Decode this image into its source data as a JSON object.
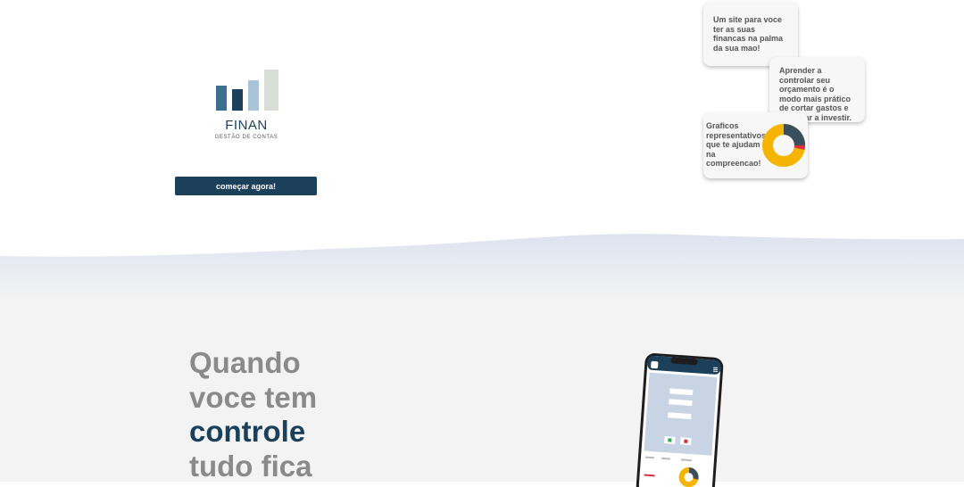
{
  "logo": {
    "title": "FINAN",
    "subtitle": "GESTÃO DE CONTAS"
  },
  "hero": {
    "cta_label": "começar agora!"
  },
  "cards": [
    {
      "text": "Um site para voce ter as suas financas na palma da sua mao!"
    },
    {
      "text": "Aprender a controlar seu orçamento é o modo mais prático de cortar gastos e começar a investir."
    },
    {
      "text": "Graficos representativos que te ajudam na compreencao!"
    }
  ],
  "headline": {
    "line1": "Quando",
    "line2": "voce tem",
    "line3": "controle",
    "line4": "tudo fica"
  },
  "colors": {
    "brand": "#1c3f5a",
    "accent_yellow": "#f4b400",
    "accent_red": "#d9303e",
    "wave": "#dde3ef",
    "lower_bg": "#f3f3f3"
  }
}
